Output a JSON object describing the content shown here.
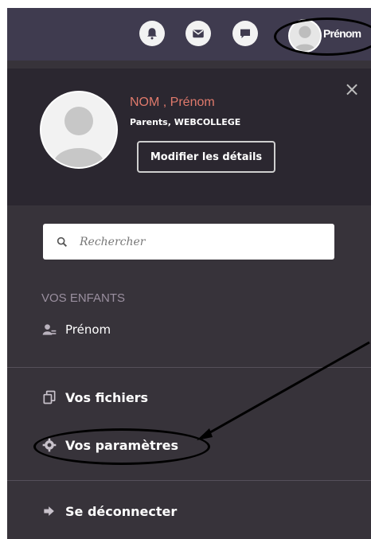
{
  "topbar": {
    "icons": [
      "bell-icon",
      "mail-icon",
      "chat-icon"
    ],
    "user_name": "Prénom"
  },
  "profile": {
    "name": "NOM , Prénom",
    "subtitle": "Parents, WEBCOLLEGE",
    "edit_label": "Modifier les détails",
    "close_label": "×"
  },
  "search": {
    "placeholder": "Rechercher"
  },
  "children": {
    "section_label": "VOS ENFANTS",
    "items": [
      {
        "name": "Prénom",
        "icon": "users-icon"
      }
    ]
  },
  "menu": {
    "files": "Vos fichiers",
    "settings": "Vos paramètres",
    "logout": "Se déconnecter"
  },
  "colors": {
    "topbar": "#3f3b4f",
    "panel": "#37333a",
    "profile_bg": "#2b2730",
    "accent_name": "#e07a6c"
  }
}
